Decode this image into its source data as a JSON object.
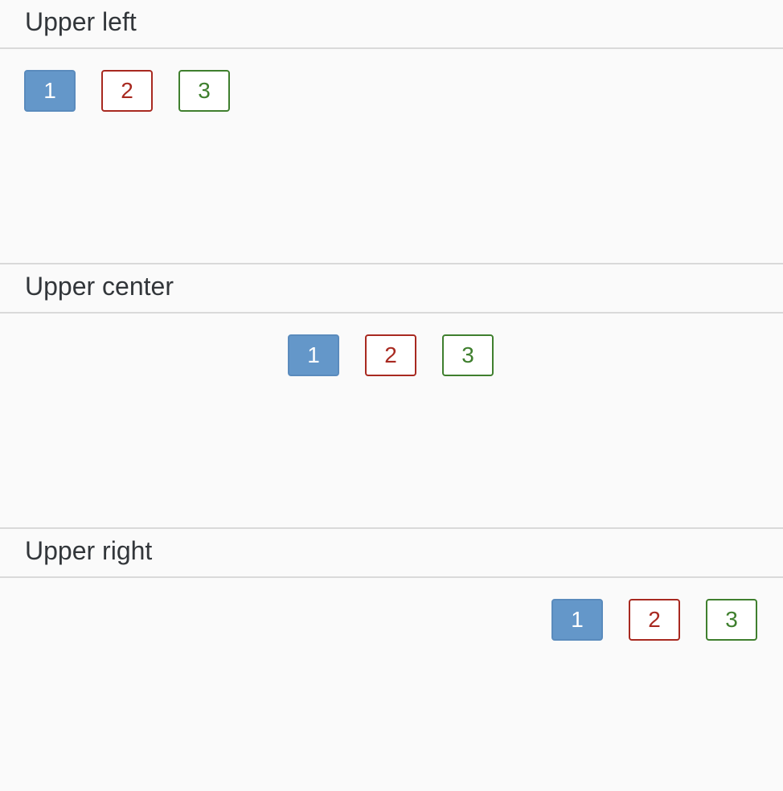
{
  "panels": [
    {
      "title": "Upper left",
      "buttons": [
        "1",
        "2",
        "3"
      ]
    },
    {
      "title": "Upper center",
      "buttons": [
        "1",
        "2",
        "3"
      ]
    },
    {
      "title": "Upper right",
      "buttons": [
        "1",
        "2",
        "3"
      ]
    }
  ],
  "colors": {
    "selected": "#6497c9",
    "negative": "#a82920",
    "positive": "#3f7f2e",
    "divider": "#d9d9d9",
    "background": "#fafafa"
  }
}
